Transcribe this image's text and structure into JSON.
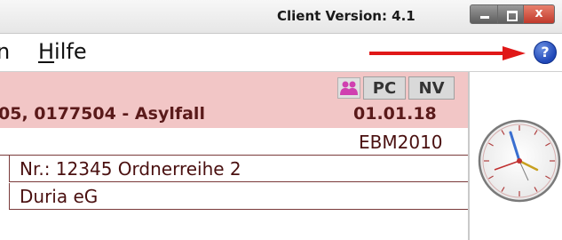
{
  "titlebar": {
    "client_version": "Client Version: 4.1",
    "controls": {
      "close_glyph": "x"
    }
  },
  "menubar": {
    "cut_item": "n",
    "help_item": {
      "accel": "H",
      "rest": "ilfe"
    },
    "help_icon_glyph": "?",
    "annotation_arrow_color": "#e01818"
  },
  "patient": {
    "header_bg": "#f2c6c6",
    "title": "05, 0177504 - Asylfall",
    "date": "01.01.18",
    "badges": {
      "pc": "PC",
      "nv": "NV"
    },
    "group_icon": "people-group-icon",
    "group_icon_color": "#d040b0"
  },
  "billing": {
    "scheme": "EBM2010",
    "fields": [
      "Nr.: 12345 Ordnerreihe 2",
      "Duria eG"
    ]
  },
  "side_widget": {
    "icon": "clock-icon"
  }
}
